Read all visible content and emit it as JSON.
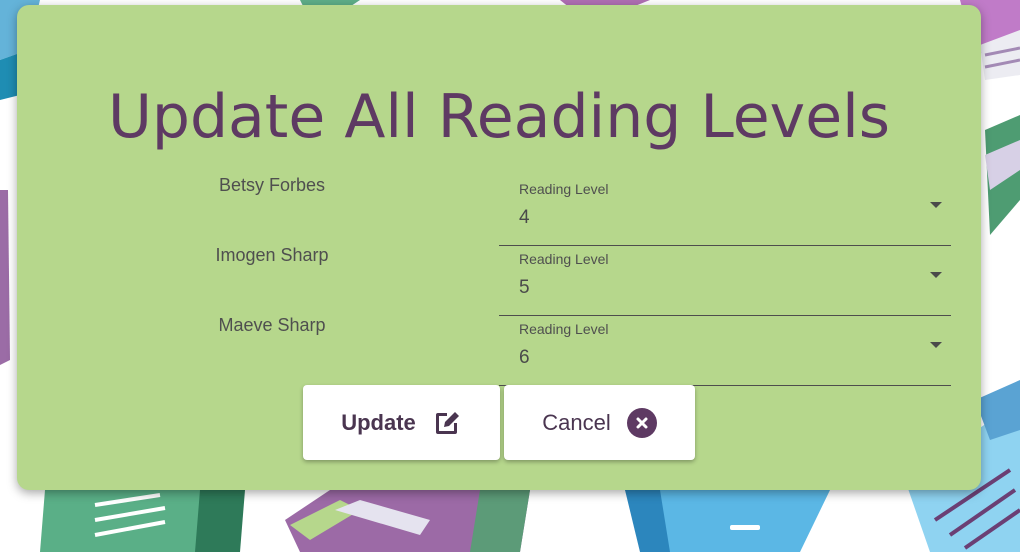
{
  "dialog": {
    "title": "Update All Reading Levels"
  },
  "students": [
    {
      "name": "Betsy Forbes",
      "field_label": "Reading Level",
      "value": "4"
    },
    {
      "name": "Imogen Sharp",
      "field_label": "Reading Level",
      "value": "5"
    },
    {
      "name": "Maeve Sharp",
      "field_label": "Reading Level",
      "value": "6"
    }
  ],
  "buttons": {
    "update_label": "Update",
    "update_icon": "edit-icon",
    "cancel_label": "Cancel",
    "cancel_icon": "close-circle-icon"
  },
  "colors": {
    "dialog_bg": "#b6d78c",
    "accent": "#5e3a63"
  }
}
